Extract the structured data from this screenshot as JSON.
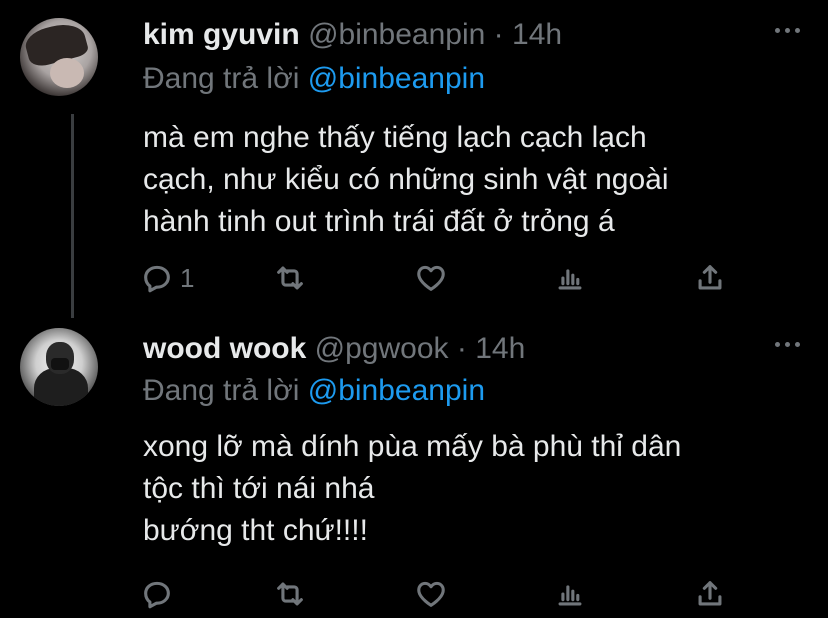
{
  "tweets": [
    {
      "name": "kim gyuvin",
      "handle": "@binbeanpin",
      "separator": "·",
      "time": "14h",
      "replying_prefix": "Đang trả lời",
      "replying_to": "@binbeanpin",
      "text": "mà em nghe thấy tiếng lạch cạch lạch\ncạch, như kiểu có những sinh vật ngoài\nhành tinh out trình trái đất ở trỏng á",
      "reply_count": "1",
      "retweet_count": "",
      "like_count": ""
    },
    {
      "name": "wood wook",
      "handle": "@pgwook",
      "separator": "·",
      "time": "14h",
      "replying_prefix": "Đang trả lời",
      "replying_to": "@binbeanpin",
      "text": "xong lỡ mà dính pùa mấy bà phù thỉ dân\ntộc thì tới nái nhá\nbướng tht chứ!!!!",
      "reply_count": "",
      "retweet_count": "",
      "like_count": ""
    }
  ],
  "icons": {
    "reply": "reply-icon",
    "retweet": "retweet-icon",
    "like": "heart-icon",
    "analytics": "analytics-icon",
    "share": "share-icon",
    "more": "more-icon"
  },
  "colors": {
    "background": "#000000",
    "text": "#e7e9ea",
    "secondary": "#71767b",
    "accent": "#1d9bf0"
  }
}
